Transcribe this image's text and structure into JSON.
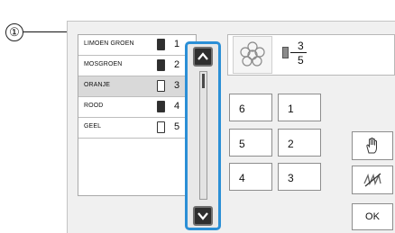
{
  "callout": {
    "number": "①"
  },
  "threads": [
    {
      "name": "LIMOEN GROEN",
      "number": "1",
      "spool": "dark",
      "selected": false
    },
    {
      "name": "MOSGROEN",
      "number": "2",
      "spool": "dark",
      "selected": false
    },
    {
      "name": "ORANJE",
      "number": "3",
      "spool": "light",
      "selected": true
    },
    {
      "name": "ROOD",
      "number": "4",
      "spool": "dark",
      "selected": false
    },
    {
      "name": "GEEL",
      "number": "5",
      "spool": "light",
      "selected": false
    }
  ],
  "scroll": {
    "up_icon": "chevron-up-icon",
    "down_icon": "chevron-down-icon"
  },
  "preview": {
    "current": "3",
    "total": "5"
  },
  "order_buttons": {
    "left": [
      "6",
      "5",
      "4"
    ],
    "right": [
      "1",
      "2",
      "3"
    ]
  },
  "actions": {
    "ok_label": "OK",
    "hand_icon": "hand-icon",
    "no_stitch_icon": "no-stitch-icon"
  },
  "colors": {
    "accent": "#2b8fd6",
    "selected_row": "#d9d9d9"
  }
}
